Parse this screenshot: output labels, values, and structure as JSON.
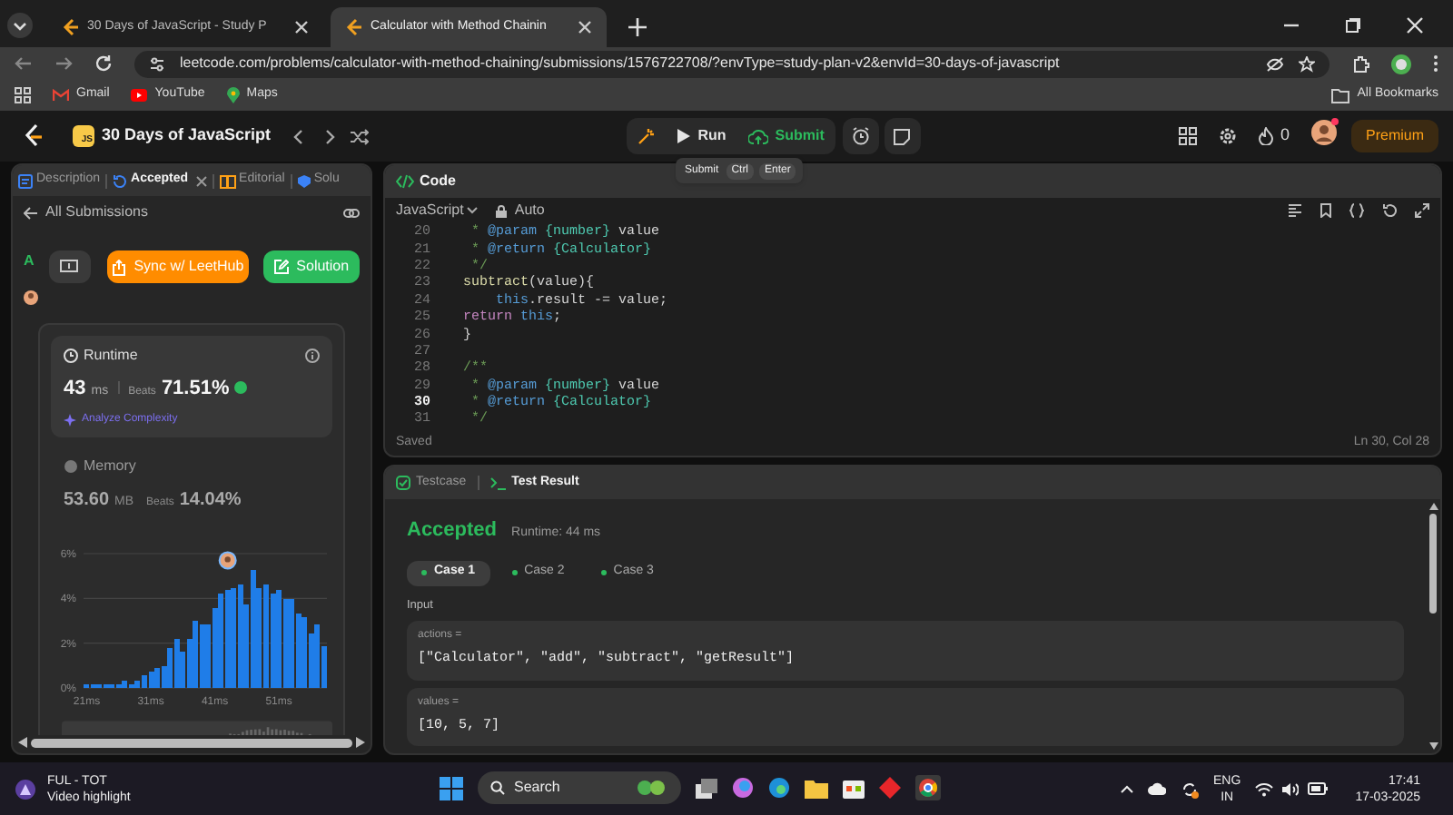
{
  "browser": {
    "tabs": [
      {
        "title": "30 Days of JavaScript - Study P",
        "selected": false
      },
      {
        "title": "Calculator with Method Chainin",
        "selected": true
      }
    ],
    "address": "leetcode.com/problems/calculator-with-method-chaining/submissions/1576722708/?envType=study-plan-v2&envId=30-days-of-javascript",
    "bookmarks": [
      "Gmail",
      "YouTube",
      "Maps"
    ],
    "all_bookmarks": "All Bookmarks"
  },
  "header": {
    "logo_badge": "JS",
    "title": "30 Days of JavaScript",
    "run": "Run",
    "submit": "Submit",
    "streak": "0",
    "premium": "Premium"
  },
  "tooltip": [
    "Submit",
    "Ctrl",
    "Enter"
  ],
  "left_panel": {
    "tabs": [
      {
        "label": "Description",
        "selected": false
      },
      {
        "label": "Accepted",
        "selected": true
      },
      {
        "label": "Editorial",
        "selected": false
      },
      {
        "label": "Solu",
        "selected": false
      }
    ],
    "back_link": "All Submissions",
    "status_letter": "A",
    "sync_button": "Sync w/ LeetHub",
    "solution_button": "Solution",
    "runtime": {
      "title": "Runtime",
      "value": "43",
      "unit": "ms",
      "beats_label": "Beats",
      "beats": "71.51%",
      "analyze": "Analyze Complexity"
    },
    "memory": {
      "title": "Memory",
      "value": "53.60",
      "unit": "MB",
      "beats_label": "Beats",
      "beats": "14.04%"
    },
    "chart_data": {
      "type": "bar",
      "x": [
        21,
        22,
        23,
        24,
        25,
        26,
        27,
        28,
        29,
        30,
        31,
        32,
        33,
        34,
        35,
        36,
        37,
        38,
        39,
        40,
        41,
        42,
        43,
        44,
        45,
        46,
        47,
        48,
        49,
        50,
        51,
        52,
        53,
        54,
        55,
        56,
        57,
        58
      ],
      "values": [
        0.2,
        0.2,
        0.2,
        0.2,
        0.2,
        0.2,
        0.3,
        0.2,
        0.3,
        0.6,
        0.7,
        0.9,
        1.0,
        1.8,
        2.2,
        1.6,
        2.2,
        3.0,
        2.8,
        2.8,
        3.6,
        4.2,
        4.4,
        4.5,
        4.6,
        3.7,
        5.3,
        4.5,
        4.6,
        4.2,
        4.4,
        4.0,
        4.0,
        3.3,
        3.2,
        2.4,
        2.8,
        1.9
      ],
      "xlim": [
        20.5,
        58.5
      ],
      "ylim": [
        0,
        6
      ],
      "grid": true,
      "yticks": [
        {
          "value": 0,
          "label": "0%"
        },
        {
          "value": 2,
          "label": "2%"
        },
        {
          "value": 4,
          "label": "4%"
        },
        {
          "value": 6,
          "label": "6%"
        }
      ],
      "xticks": [
        {
          "value": 21,
          "label": "21ms"
        },
        {
          "value": 31,
          "label": "31ms"
        },
        {
          "value": 41,
          "label": "41ms"
        },
        {
          "value": 51,
          "label": "51ms"
        }
      ]
    }
  },
  "code_panel": {
    "title": "Code",
    "language": "JavaScript",
    "mode": "Auto",
    "lines": [
      {
        "number": "20",
        "current": false,
        "tokens": [
          {
            "text": " * ",
            "kind": "comment"
          },
          {
            "text": "@param",
            "kind": "tag"
          },
          {
            "text": " {number} ",
            "kind": "type"
          },
          {
            "text": "value",
            "kind": "plain"
          }
        ]
      },
      {
        "number": "21",
        "current": false,
        "tokens": [
          {
            "text": " * ",
            "kind": "comment"
          },
          {
            "text": "@return",
            "kind": "tag"
          },
          {
            "text": " {Calculator}",
            "kind": "type"
          }
        ]
      },
      {
        "number": "22",
        "current": false,
        "tokens": [
          {
            "text": " */",
            "kind": "comment"
          }
        ]
      },
      {
        "number": "23",
        "current": false,
        "tokens": [
          {
            "text": "subtract",
            "kind": "fn"
          },
          {
            "text": "(value){",
            "kind": "plain"
          }
        ]
      },
      {
        "number": "24",
        "current": false,
        "tokens": [
          {
            "text": "    this",
            "kind": "tag"
          },
          {
            "text": ".result -= value;",
            "kind": "plain"
          }
        ]
      },
      {
        "number": "25",
        "current": false,
        "tokens": [
          {
            "text": "return",
            "kind": "keyword"
          },
          {
            "text": " this",
            "kind": "tag"
          },
          {
            "text": ";",
            "kind": "plain"
          }
        ]
      },
      {
        "number": "26",
        "current": false,
        "tokens": [
          {
            "text": "}",
            "kind": "plain"
          }
        ]
      },
      {
        "number": "27",
        "current": false
      },
      {
        "number": "28",
        "current": false,
        "tokens": [
          {
            "text": "/**",
            "kind": "comment"
          }
        ]
      },
      {
        "number": "29",
        "current": false,
        "tokens": [
          {
            "text": " * ",
            "kind": "comment"
          },
          {
            "text": "@param",
            "kind": "tag"
          },
          {
            "text": " {number} ",
            "kind": "type"
          },
          {
            "text": "value",
            "kind": "plain"
          }
        ]
      },
      {
        "number": "30",
        "current": true,
        "tokens": [
          {
            "text": " * ",
            "kind": "comment"
          },
          {
            "text": "@return",
            "kind": "tag"
          },
          {
            "text": " {Calculator}",
            "kind": "type"
          }
        ]
      },
      {
        "number": "31",
        "current": false,
        "tokens": [
          {
            "text": " */",
            "kind": "comment"
          }
        ]
      }
    ],
    "saved": "Saved",
    "cursor": "Ln 30, Col 28"
  },
  "test_panel": {
    "tabs": [
      {
        "label": "Testcase",
        "selected": false
      },
      {
        "label": "Test Result",
        "selected": true
      }
    ],
    "verdict": "Accepted",
    "runtime": "Runtime: 44 ms",
    "cases": [
      {
        "label": "Case 1",
        "selected": true
      },
      {
        "label": "Case 2",
        "selected": false
      },
      {
        "label": "Case 3",
        "selected": false
      }
    ],
    "input_label": "Input",
    "inputs": [
      {
        "name": "actions =",
        "value": "[\"Calculator\", \"add\", \"subtract\", \"getResult\"]"
      },
      {
        "name": "values =",
        "value": "[10, 5, 7]"
      }
    ]
  },
  "taskbar": {
    "widget_title": "FUL - TOT",
    "widget_subtitle": "Video highlight",
    "search": "Search",
    "lang": "ENG",
    "region": "IN",
    "time": "17:41",
    "date": "17-03-2025"
  }
}
